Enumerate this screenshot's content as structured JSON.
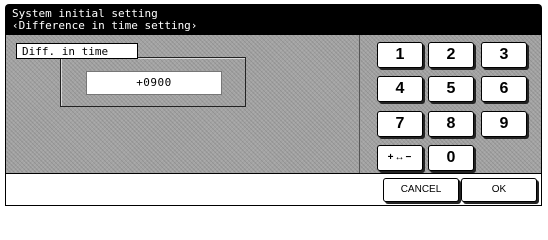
{
  "header": {
    "title": "System initial setting",
    "subtitle": "‹Difference in time setting›"
  },
  "setting": {
    "label": "Diff. in time",
    "value": "+0900"
  },
  "keypad": {
    "keys": [
      "1",
      "2",
      "3",
      "4",
      "5",
      "6",
      "7",
      "8",
      "9",
      "+↔−",
      "0"
    ]
  },
  "footer": {
    "cancel_label": "CANCEL",
    "ok_label": "OK"
  }
}
